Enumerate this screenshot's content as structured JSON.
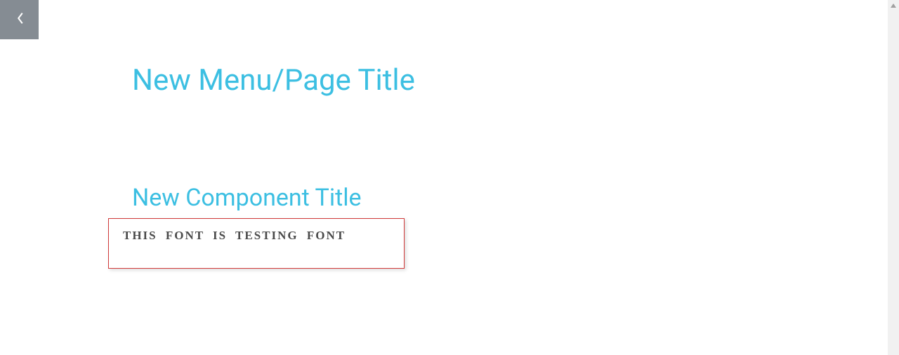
{
  "page": {
    "title": "New Menu/Page Title",
    "component_title": "New Component Title",
    "font_test_text": "THIS FONT IS TESTING FONT"
  }
}
